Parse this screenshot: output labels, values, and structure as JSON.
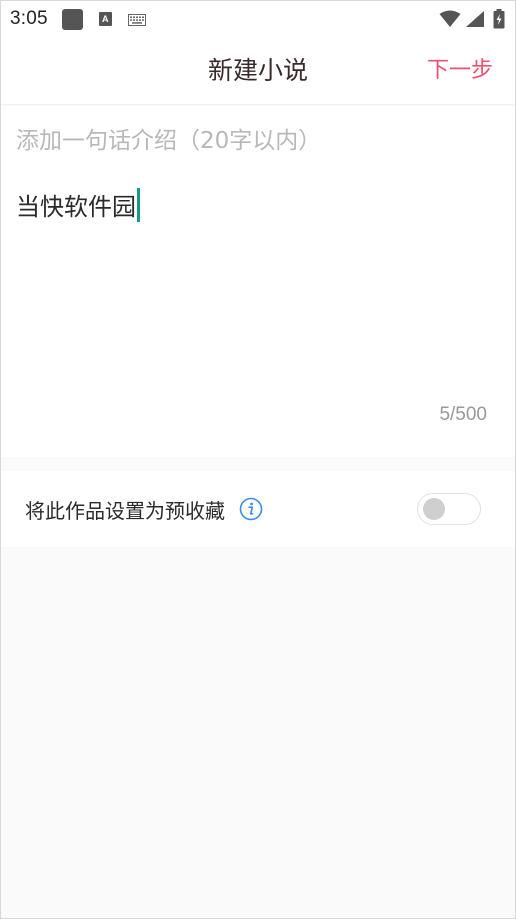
{
  "status_bar": {
    "time": "3:05",
    "icons": [
      "notification-square-icon",
      "a-text-icon",
      "keyboard-icon",
      "wifi-icon",
      "signal-icon",
      "battery-charging-icon"
    ]
  },
  "toolbar": {
    "title": "新建小说",
    "next_label": "下一步"
  },
  "editor": {
    "intro_placeholder": "添加一句话介绍（20字以内）",
    "content_value": "当快软件园",
    "char_count": "5/500"
  },
  "settings": {
    "presale_label": "将此作品设置为预收藏",
    "presale_enabled": false
  },
  "colors": {
    "accent": "#f0506e",
    "caret": "#169a8a",
    "info_icon": "#3a8ee6",
    "background": "#fafafa"
  }
}
